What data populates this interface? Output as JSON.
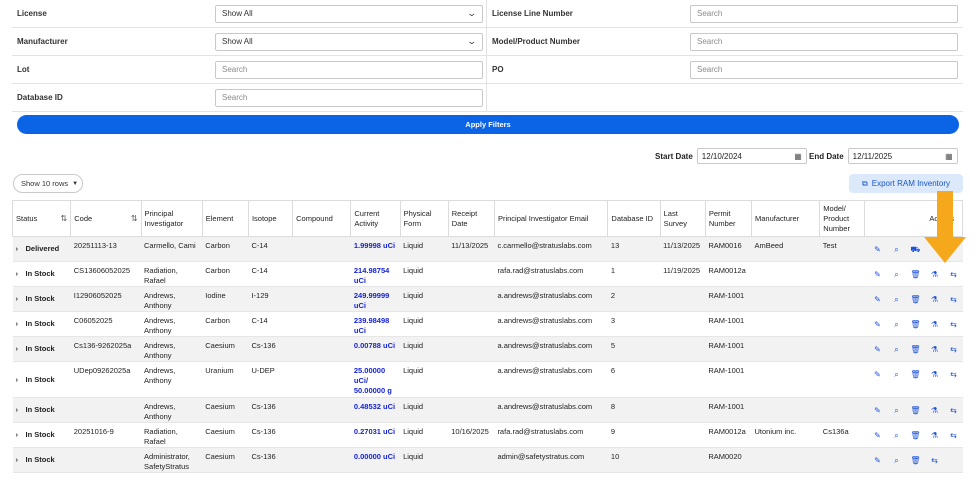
{
  "filters": {
    "row1": {
      "left_label": "License",
      "left_value": "Show All",
      "right_label": "License Line Number",
      "right_placeholder": "Search"
    },
    "row2": {
      "left_label": "Manufacturer",
      "left_value": "Show All",
      "right_label": "Model/Product Number",
      "right_placeholder": "Search"
    },
    "row3": {
      "left_label": "Lot",
      "left_placeholder": "Search",
      "right_label": "PO",
      "right_placeholder": "Search"
    },
    "row4": {
      "left_label": "Database ID",
      "left_placeholder": "Search"
    },
    "apply_label": "Apply Filters"
  },
  "dates": {
    "start_label": "Start Date",
    "start_value": "12/10/2024",
    "end_label": "End Date",
    "end_value": "12/11/2025"
  },
  "toolbar": {
    "show_rows": "Show 10 rows",
    "export_label": "Export RAM Inventory"
  },
  "table": {
    "headers": [
      "Status",
      "Code",
      "Principal Investigator",
      "Element",
      "Isotope",
      "Compound",
      "Current Activity",
      "Physical Form",
      "Receipt Date",
      "Principal Investigator Email",
      "Database ID",
      "Last Survey",
      "Permit Number",
      "Manufacturer",
      "Model/ Product Number",
      "Actions"
    ],
    "rows": [
      {
        "status": "Delivered",
        "code": "20251113-13",
        "pi": "Carmello, Cami",
        "element": "Carbon",
        "isotope": "C-14",
        "compound": "",
        "activity": "1.99998 uCi",
        "form": "Liquid",
        "receipt": "11/13/2025",
        "email": "c.carmello@stratuslabs.com",
        "dbid": "13",
        "survey": "11/13/2025",
        "permit": "RAM0016",
        "mfr": "AmBeed",
        "model": "Test"
      },
      {
        "status": "In Stock",
        "code": "CS13606052025",
        "pi": "Radiation, Rafael",
        "element": "Carbon",
        "isotope": "C-14",
        "compound": "",
        "activity": "214.98754 uCi",
        "form": "Liquid",
        "receipt": "",
        "email": "rafa.rad@stratuslabs.com",
        "dbid": "1",
        "survey": "11/19/2025",
        "permit": "RAM0012a",
        "mfr": "",
        "model": ""
      },
      {
        "status": "In Stock",
        "code": "I12906052025",
        "pi": "Andrews, Anthony",
        "element": "Iodine",
        "isotope": "I-129",
        "compound": "",
        "activity": "249.99999 uCi",
        "form": "Liquid",
        "receipt": "",
        "email": "a.andrews@stratuslabs.com",
        "dbid": "2",
        "survey": "",
        "permit": "RAM-1001",
        "mfr": "",
        "model": ""
      },
      {
        "status": "In Stock",
        "code": "C06052025",
        "pi": "Andrews, Anthony",
        "element": "Carbon",
        "isotope": "C-14",
        "compound": "",
        "activity": "239.98498 uCi",
        "form": "Liquid",
        "receipt": "",
        "email": "a.andrews@stratuslabs.com",
        "dbid": "3",
        "survey": "",
        "permit": "RAM-1001",
        "mfr": "",
        "model": ""
      },
      {
        "status": "In Stock",
        "code": "Cs136-9262025a",
        "pi": "Andrews, Anthony",
        "element": "Caesium",
        "isotope": "Cs-136",
        "compound": "",
        "activity": "0.00788 uCi",
        "form": "Liquid",
        "receipt": "",
        "email": "a.andrews@stratuslabs.com",
        "dbid": "5",
        "survey": "",
        "permit": "RAM-1001",
        "mfr": "",
        "model": ""
      },
      {
        "status": "In Stock",
        "code": "UDep09262025a",
        "pi": "Andrews, Anthony",
        "element": "Uranium",
        "isotope": "U-DEP",
        "compound": "",
        "activity": "25.00000 uCi/ 50.00000 g",
        "form": "Liquid",
        "receipt": "",
        "email": "a.andrews@stratuslabs.com",
        "dbid": "6",
        "survey": "",
        "permit": "RAM-1001",
        "mfr": "",
        "model": ""
      },
      {
        "status": "In Stock",
        "code": "",
        "pi": "Andrews, Anthony",
        "element": "Caesium",
        "isotope": "Cs-136",
        "compound": "",
        "activity": "0.48532 uCi",
        "form": "Liquid",
        "receipt": "",
        "email": "a.andrews@stratuslabs.com",
        "dbid": "8",
        "survey": "",
        "permit": "RAM-1001",
        "mfr": "",
        "model": ""
      },
      {
        "status": "In Stock",
        "code": "20251016-9",
        "pi": "Radiation, Rafael",
        "element": "Caesium",
        "isotope": "Cs-136",
        "compound": "",
        "activity": "0.27031 uCi",
        "form": "Liquid",
        "receipt": "10/16/2025",
        "email": "rafa.rad@stratuslabs.com",
        "dbid": "9",
        "survey": "",
        "permit": "RAM0012a",
        "mfr": "Utonium inc.",
        "model": "Cs136a"
      },
      {
        "status": "In Stock",
        "code": "",
        "pi": "Administrator, SafetyStratus",
        "element": "Caesium",
        "isotope": "Cs-136",
        "compound": "",
        "activity": "0.00000 uCi",
        "form": "Liquid",
        "receipt": "",
        "email": "admin@safetystratus.com",
        "dbid": "10",
        "survey": "",
        "permit": "RAM0020",
        "mfr": "",
        "model": ""
      }
    ]
  },
  "icons": {
    "edit": "pencil-icon",
    "view": "magnifier-icon",
    "delete": "trash-icon",
    "lab": "flask-icon",
    "transfer": "transfer-icon",
    "receive": "package-icon"
  },
  "colors": {
    "primary": "#0b63e5",
    "activity_text": "#1523d9",
    "highlight_arrow": "#f5a81c"
  }
}
